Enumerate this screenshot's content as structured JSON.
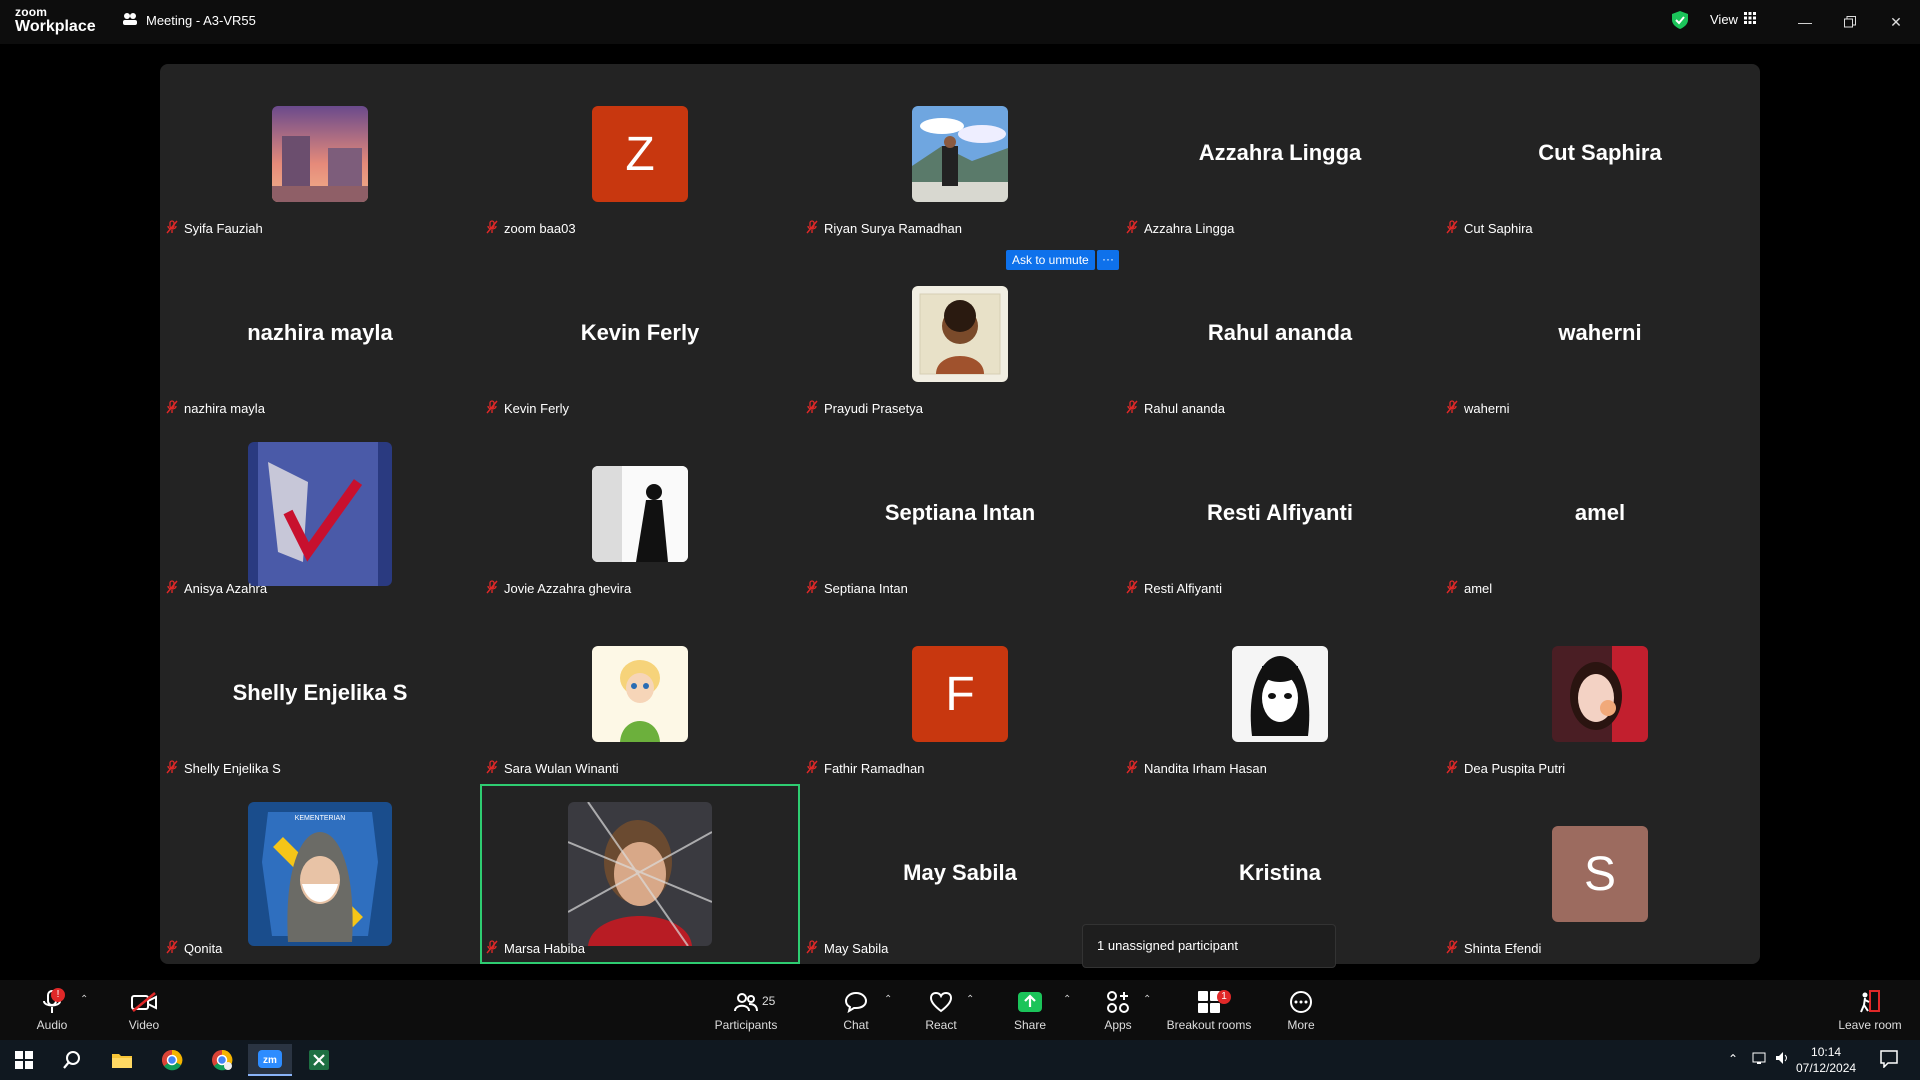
{
  "titlebar": {
    "logo_line1": "zoom",
    "logo_line2": "Workplace",
    "meeting_title": "Meeting - A3-VR55",
    "view_label": "View"
  },
  "gallery": {
    "tiles": [
      {
        "name": "Syifa Fauziah",
        "display": "photo",
        "photo": "sunset-street"
      },
      {
        "name": "zoom baa03",
        "display": "initial",
        "initial": "Z",
        "color": "#c8370f"
      },
      {
        "name": "Riyan Surya Ramadhan",
        "display": "photo",
        "photo": "mountain-selfie"
      },
      {
        "name": "Azzahra Lingga",
        "display": "name"
      },
      {
        "name": "Cut Saphira",
        "display": "name"
      },
      {
        "name": "nazhira mayla",
        "display": "name"
      },
      {
        "name": "Kevin Ferly",
        "display": "name"
      },
      {
        "name": "Prayudi Prasetya",
        "display": "photo",
        "photo": "portrait-sketch"
      },
      {
        "name": "Rahul ananda",
        "display": "name"
      },
      {
        "name": "waherni",
        "display": "name"
      },
      {
        "name": "Anisya Azahra",
        "display": "photo-big",
        "photo": "blue-paper"
      },
      {
        "name": "Jovie Azzahra ghevira",
        "display": "photo",
        "photo": "silhouette"
      },
      {
        "name": "Septiana Intan",
        "display": "name"
      },
      {
        "name": "Resti Alfiyanti",
        "display": "name"
      },
      {
        "name": "amel",
        "display": "name"
      },
      {
        "name": "Shelly Enjelika S",
        "display": "name"
      },
      {
        "name": "Sara Wulan Winanti",
        "display": "photo",
        "photo": "tinkerbell"
      },
      {
        "name": "Fathir Ramadhan",
        "display": "initial",
        "initial": "F",
        "color": "#c8370f"
      },
      {
        "name": "Nandita Irham Hasan",
        "display": "photo",
        "photo": "anime-girl"
      },
      {
        "name": "Dea Puspita Putri",
        "display": "photo",
        "photo": "selfie-girl"
      },
      {
        "name": "Qonita",
        "display": "photo-big",
        "photo": "hijab-mask"
      },
      {
        "name": "Marsa Habiba",
        "display": "photo-big",
        "photo": "spider-man",
        "active": true
      },
      {
        "name": "May Sabila",
        "display": "name"
      },
      {
        "name": "Kristina",
        "display": "name",
        "hide_label": true
      },
      {
        "name": "Shinta Efendi",
        "display": "initial",
        "initial": "S",
        "color": "#9c6b5f"
      }
    ],
    "ask_unmute_label": "Ask to unmute",
    "ask_more_label": "···",
    "tooltip_text": "1 unassigned participant"
  },
  "toolbar": {
    "audio_label": "Audio",
    "video_label": "Video",
    "participants_label": "Participants",
    "participants_count": "25",
    "chat_label": "Chat",
    "react_label": "React",
    "share_label": "Share",
    "apps_label": "Apps",
    "breakout_label": "Breakout rooms",
    "breakout_badge": "1",
    "more_label": "More",
    "leave_label": "Leave room",
    "audio_badge": "!"
  },
  "taskbar": {
    "time": "10:14",
    "date": "07/12/2024"
  },
  "colors": {
    "accent": "#0e71eb",
    "share_green": "#1bc45a",
    "active_speaker": "#2ecc71",
    "muted_red": "#e02828"
  }
}
